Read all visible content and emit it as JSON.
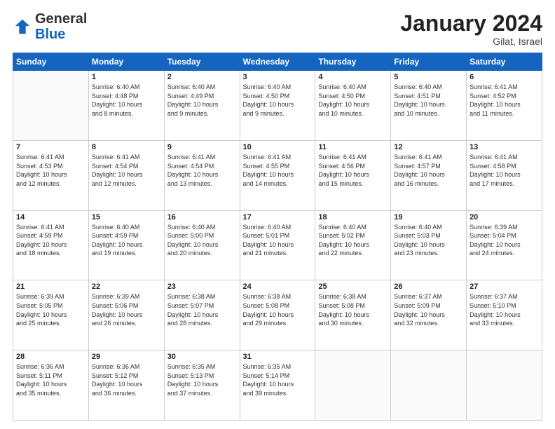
{
  "header": {
    "logo_general": "General",
    "logo_blue": "Blue",
    "month": "January 2024",
    "location": "Gilat, Israel"
  },
  "days_of_week": [
    "Sunday",
    "Monday",
    "Tuesday",
    "Wednesday",
    "Thursday",
    "Friday",
    "Saturday"
  ],
  "weeks": [
    [
      {
        "day": "",
        "info": ""
      },
      {
        "day": "1",
        "info": "Sunrise: 6:40 AM\nSunset: 4:48 PM\nDaylight: 10 hours\nand 8 minutes."
      },
      {
        "day": "2",
        "info": "Sunrise: 6:40 AM\nSunset: 4:49 PM\nDaylight: 10 hours\nand 9 minutes."
      },
      {
        "day": "3",
        "info": "Sunrise: 6:40 AM\nSunset: 4:50 PM\nDaylight: 10 hours\nand 9 minutes."
      },
      {
        "day": "4",
        "info": "Sunrise: 6:40 AM\nSunset: 4:50 PM\nDaylight: 10 hours\nand 10 minutes."
      },
      {
        "day": "5",
        "info": "Sunrise: 6:40 AM\nSunset: 4:51 PM\nDaylight: 10 hours\nand 10 minutes."
      },
      {
        "day": "6",
        "info": "Sunrise: 6:41 AM\nSunset: 4:52 PM\nDaylight: 10 hours\nand 11 minutes."
      }
    ],
    [
      {
        "day": "7",
        "info": "Sunrise: 6:41 AM\nSunset: 4:53 PM\nDaylight: 10 hours\nand 12 minutes."
      },
      {
        "day": "8",
        "info": "Sunrise: 6:41 AM\nSunset: 4:54 PM\nDaylight: 10 hours\nand 12 minutes."
      },
      {
        "day": "9",
        "info": "Sunrise: 6:41 AM\nSunset: 4:54 PM\nDaylight: 10 hours\nand 13 minutes."
      },
      {
        "day": "10",
        "info": "Sunrise: 6:41 AM\nSunset: 4:55 PM\nDaylight: 10 hours\nand 14 minutes."
      },
      {
        "day": "11",
        "info": "Sunrise: 6:41 AM\nSunset: 4:56 PM\nDaylight: 10 hours\nand 15 minutes."
      },
      {
        "day": "12",
        "info": "Sunrise: 6:41 AM\nSunset: 4:57 PM\nDaylight: 10 hours\nand 16 minutes."
      },
      {
        "day": "13",
        "info": "Sunrise: 6:41 AM\nSunset: 4:58 PM\nDaylight: 10 hours\nand 17 minutes."
      }
    ],
    [
      {
        "day": "14",
        "info": "Sunrise: 6:41 AM\nSunset: 4:59 PM\nDaylight: 10 hours\nand 18 minutes."
      },
      {
        "day": "15",
        "info": "Sunrise: 6:40 AM\nSunset: 4:59 PM\nDaylight: 10 hours\nand 19 minutes."
      },
      {
        "day": "16",
        "info": "Sunrise: 6:40 AM\nSunset: 5:00 PM\nDaylight: 10 hours\nand 20 minutes."
      },
      {
        "day": "17",
        "info": "Sunrise: 6:40 AM\nSunset: 5:01 PM\nDaylight: 10 hours\nand 21 minutes."
      },
      {
        "day": "18",
        "info": "Sunrise: 6:40 AM\nSunset: 5:02 PM\nDaylight: 10 hours\nand 22 minutes."
      },
      {
        "day": "19",
        "info": "Sunrise: 6:40 AM\nSunset: 5:03 PM\nDaylight: 10 hours\nand 23 minutes."
      },
      {
        "day": "20",
        "info": "Sunrise: 6:39 AM\nSunset: 5:04 PM\nDaylight: 10 hours\nand 24 minutes."
      }
    ],
    [
      {
        "day": "21",
        "info": "Sunrise: 6:39 AM\nSunset: 5:05 PM\nDaylight: 10 hours\nand 25 minutes."
      },
      {
        "day": "22",
        "info": "Sunrise: 6:39 AM\nSunset: 5:06 PM\nDaylight: 10 hours\nand 26 minutes."
      },
      {
        "day": "23",
        "info": "Sunrise: 6:38 AM\nSunset: 5:07 PM\nDaylight: 10 hours\nand 28 minutes."
      },
      {
        "day": "24",
        "info": "Sunrise: 6:38 AM\nSunset: 5:08 PM\nDaylight: 10 hours\nand 29 minutes."
      },
      {
        "day": "25",
        "info": "Sunrise: 6:38 AM\nSunset: 5:08 PM\nDaylight: 10 hours\nand 30 minutes."
      },
      {
        "day": "26",
        "info": "Sunrise: 6:37 AM\nSunset: 5:09 PM\nDaylight: 10 hours\nand 32 minutes."
      },
      {
        "day": "27",
        "info": "Sunrise: 6:37 AM\nSunset: 5:10 PM\nDaylight: 10 hours\nand 33 minutes."
      }
    ],
    [
      {
        "day": "28",
        "info": "Sunrise: 6:36 AM\nSunset: 5:11 PM\nDaylight: 10 hours\nand 35 minutes."
      },
      {
        "day": "29",
        "info": "Sunrise: 6:36 AM\nSunset: 5:12 PM\nDaylight: 10 hours\nand 36 minutes."
      },
      {
        "day": "30",
        "info": "Sunrise: 6:35 AM\nSunset: 5:13 PM\nDaylight: 10 hours\nand 37 minutes."
      },
      {
        "day": "31",
        "info": "Sunrise: 6:35 AM\nSunset: 5:14 PM\nDaylight: 10 hours\nand 39 minutes."
      },
      {
        "day": "",
        "info": ""
      },
      {
        "day": "",
        "info": ""
      },
      {
        "day": "",
        "info": ""
      }
    ]
  ]
}
